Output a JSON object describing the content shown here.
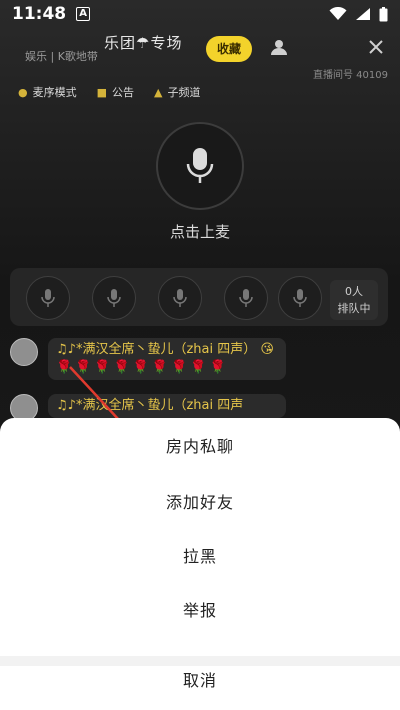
{
  "status": {
    "time": "11:48",
    "notif": "A"
  },
  "header": {
    "title": "乐团☂专场",
    "subtitle": "娱乐 | K歌地带",
    "favorite_label": "收藏",
    "room_id": "直播间号 40109"
  },
  "toolbar": {
    "items": [
      {
        "label": "麦序模式",
        "icon": "mic-icon"
      },
      {
        "label": "公告",
        "icon": "announcement-icon"
      },
      {
        "label": "子频道",
        "icon": "home-icon"
      }
    ]
  },
  "stage": {
    "mic_label": "点击上麦"
  },
  "seats": {
    "queue_count": "0人",
    "queue_label": "排队中"
  },
  "messages": [
    {
      "text": "♫♪*满汉全席丶蛰儿（zhai 四声）",
      "emoji": "😘",
      "roses": "🌹🌹🌹🌹🌹🌹🌹🌹🌹"
    },
    {
      "text": "♫♪*满汉全席丶蛰儿（zhai 四声"
    }
  ],
  "sheet": {
    "items": [
      "房内私聊",
      "添加好友",
      "拉黑",
      "举报"
    ],
    "cancel": "取消"
  },
  "colors": {
    "accent": "#f3d32b",
    "arrow": "#e03a2e"
  }
}
